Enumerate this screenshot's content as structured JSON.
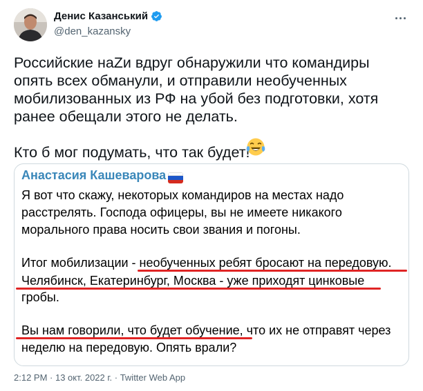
{
  "author": {
    "display_name": "Денис Казанський",
    "handle": "@den_kazansky"
  },
  "tweet": {
    "text": "Российские наZи вдруг обнаружили что командиры опять всех обманули, и отправили необученных мобилизованных из РФ на убой без подготовки, хотя ранее обещали этого не делать.\n\nКто б мог подумать, что так будет!",
    "emoji": "face-with-tears-of-joy"
  },
  "card": {
    "author": "Анастасия Кашеварова",
    "lines": [
      "Я вот что скажу, некоторых командиров на местах надо",
      "расстрелять. Господа офицеры, вы не имеете никакого",
      "морального права носить свои звания и погоны.",
      "Итог мобилизации - необученных ребят бросают на передовую.",
      "Челябинск, Екатеринбург, Москва - уже приходят цинковые",
      "гробы.",
      "Вы нам говорили, что будет обучение, что их не отправят через",
      "неделю на передовую. Опять врали?"
    ]
  },
  "footer": {
    "time": "2:12 PM · 13 окт. 2022 г. · Twitter Web App"
  },
  "colors": {
    "verified": "#1d9bf0",
    "card_author": "#3a87b9",
    "underline": "#e02424",
    "muted": "#536471"
  }
}
